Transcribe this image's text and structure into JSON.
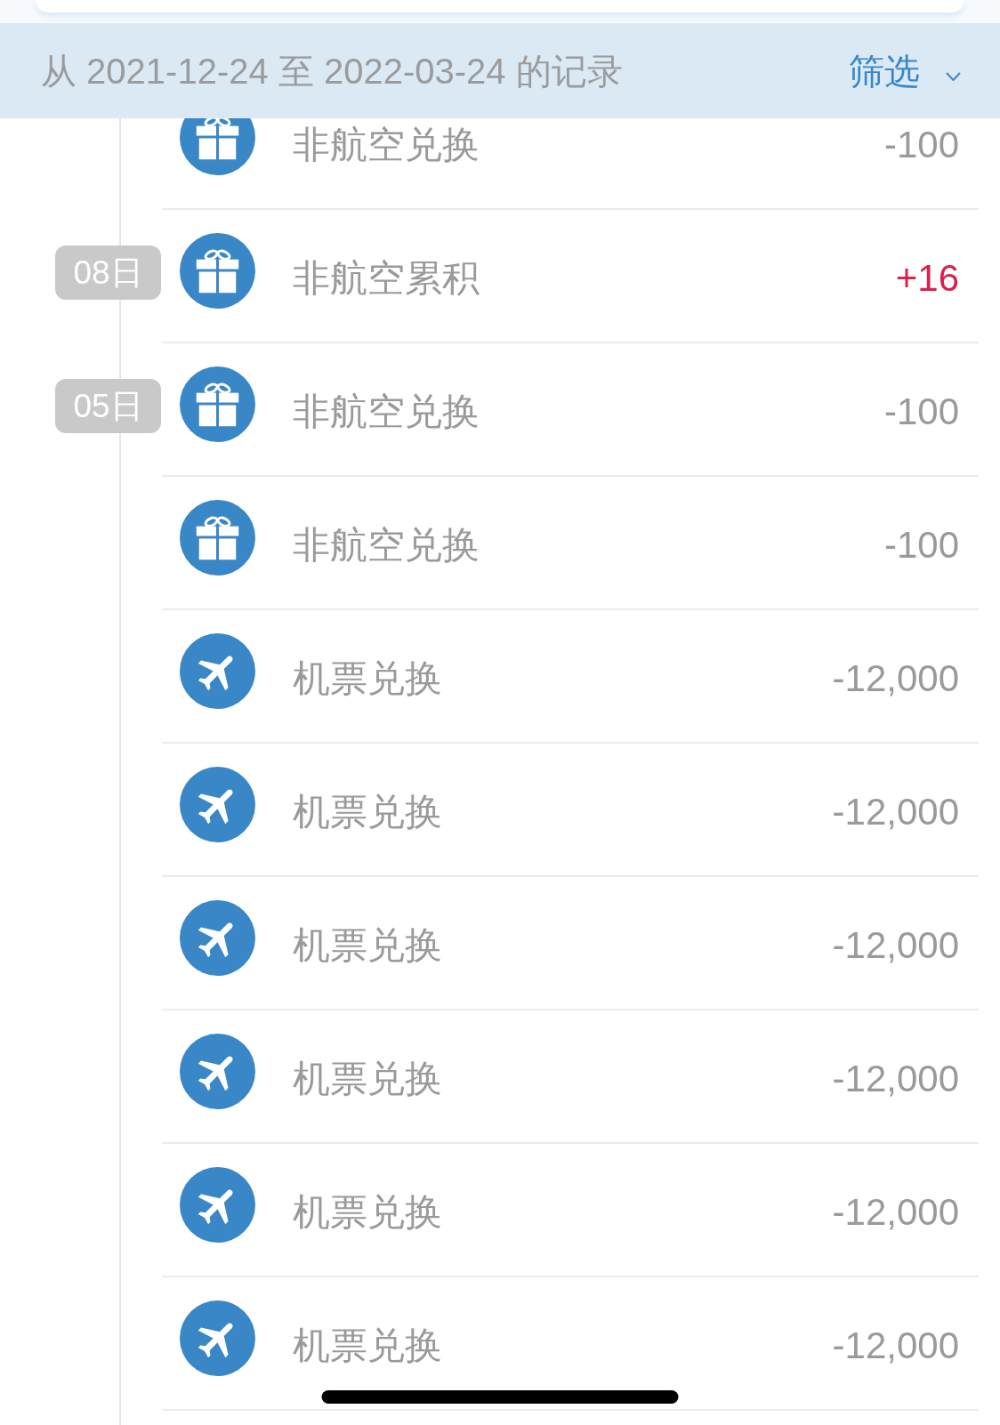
{
  "header": {
    "range_text": "从 2021-12-24 至 2022-03-24 的记录",
    "filter_button": {
      "label": "筛选"
    }
  },
  "records": [
    {
      "kind": "non_flight",
      "label": "非航空兑换",
      "amount": "-100",
      "credit": false
    },
    {
      "kind": "non_flight",
      "date": "08日",
      "label": "非航空累积",
      "amount": "+16",
      "credit": true
    },
    {
      "kind": "non_flight",
      "date": "05日",
      "label": "非航空兑换",
      "amount": "-100",
      "credit": false
    },
    {
      "kind": "non_flight",
      "label": "非航空兑换",
      "amount": "-100",
      "credit": false
    },
    {
      "kind": "flight",
      "label": "机票兑换",
      "amount": "-12,000",
      "credit": false
    },
    {
      "kind": "flight",
      "label": "机票兑换",
      "amount": "-12,000",
      "credit": false
    },
    {
      "kind": "flight",
      "label": "机票兑换",
      "amount": "-12,000",
      "credit": false
    },
    {
      "kind": "flight",
      "label": "机票兑换",
      "amount": "-12,000",
      "credit": false
    },
    {
      "kind": "flight",
      "label": "机票兑换",
      "amount": "-12,000",
      "credit": false
    },
    {
      "kind": "flight",
      "label": "机票兑换",
      "amount": "-12,000",
      "credit": false
    }
  ]
}
